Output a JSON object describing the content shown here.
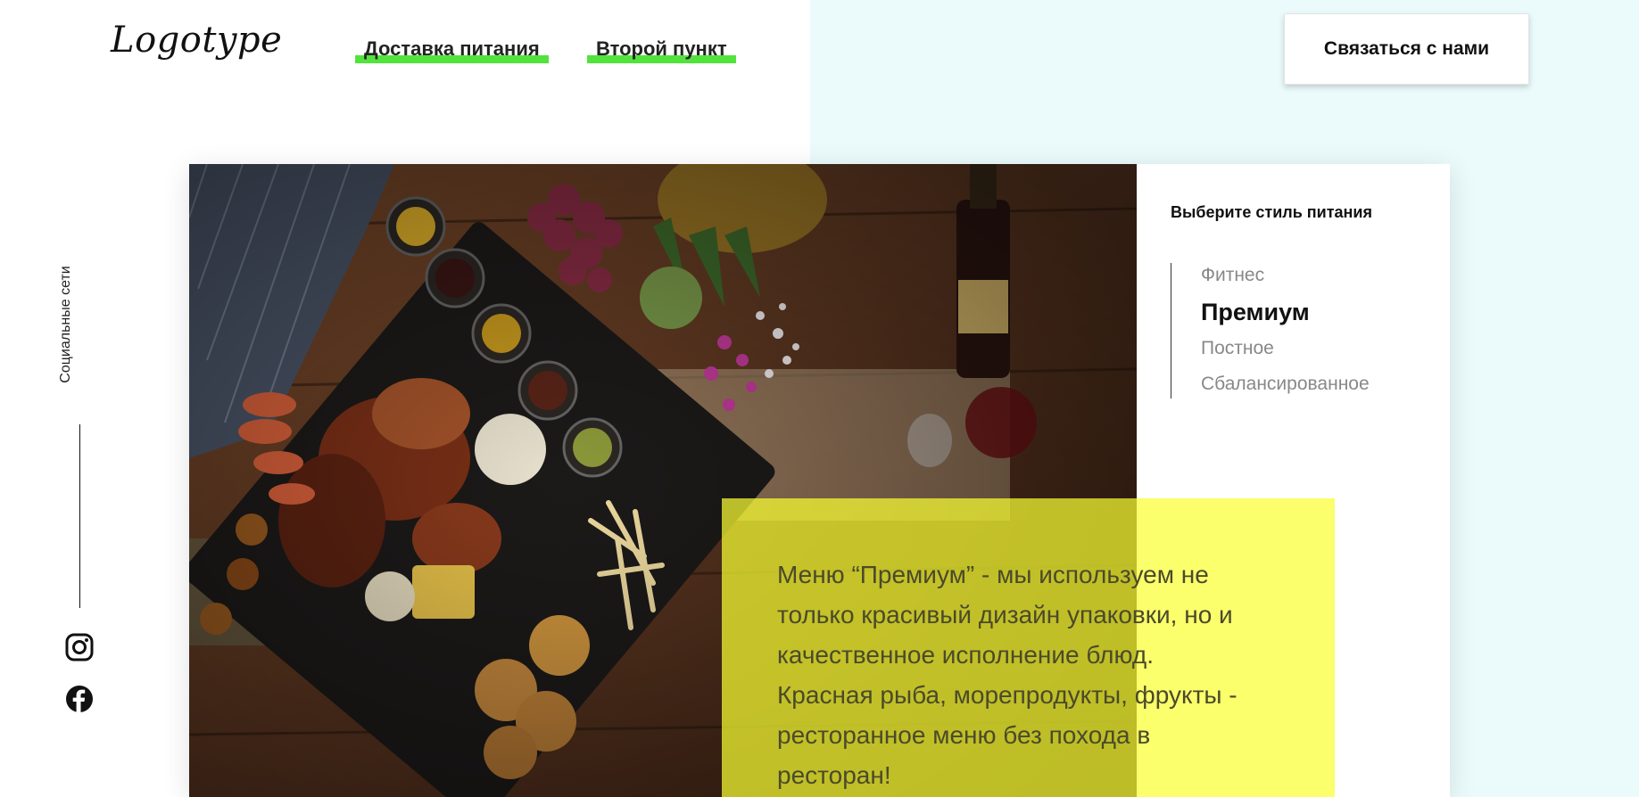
{
  "header": {
    "logo": "Logotype",
    "nav": [
      {
        "label": "Доставка питания"
      },
      {
        "label": "Второй пункт"
      }
    ],
    "contact_label": "Связаться с нами"
  },
  "social": {
    "label": "Социальные сети",
    "icons": [
      "instagram-icon",
      "facebook-icon"
    ]
  },
  "styles": {
    "title": "Выберите стиль питания",
    "items": [
      "Фитнес",
      "Премиум",
      "Постное",
      "Сбалансированное"
    ],
    "active_index": 1
  },
  "description": {
    "lines": [
      "Меню “Премиум” - мы используем не",
      "только красивый дизайн упаковки, но и",
      "качественное исполнение блюд.",
      "Красная рыба, морепродукты, фрукты -",
      "ресторанное меню без похода в",
      "ресторан!"
    ]
  },
  "colors": {
    "accent_green": "#52e43c",
    "highlight_yellow": "#faff32",
    "right_bg": "#ebfbfc"
  }
}
